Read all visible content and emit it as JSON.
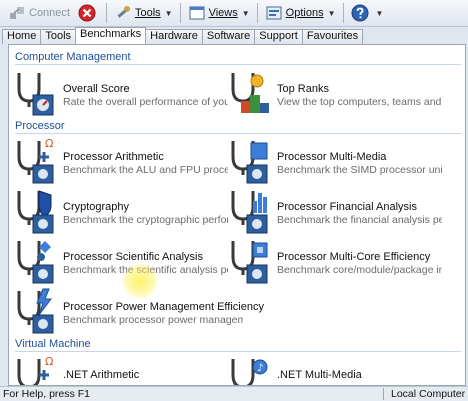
{
  "toolbar": {
    "connect_label": "Connect",
    "tools_label": "Tools",
    "views_label": "Views",
    "options_label": "Options"
  },
  "tabs": [
    "Home",
    "Tools",
    "Benchmarks",
    "Hardware",
    "Software",
    "Support",
    "Favourites"
  ],
  "active_tab": "Benchmarks",
  "sections": {
    "computer_management": "Computer Management",
    "processor": "Processor",
    "virtual_machine": "Virtual Machine"
  },
  "items": {
    "overall_score": {
      "title": "Overall Score",
      "desc": "Rate the overall performance of your co..."
    },
    "top_ranks": {
      "title": "Top Ranks",
      "desc": "View the top computers, teams and users"
    },
    "proc_arith": {
      "title": "Processor Arithmetic",
      "desc": "Benchmark the ALU and FPU processor ..."
    },
    "proc_mm": {
      "title": "Processor Multi-Media",
      "desc": "Benchmark the SIMD processor units"
    },
    "crypto": {
      "title": "Cryptography",
      "desc": "Benchmark the cryptographic performa..."
    },
    "proc_fin": {
      "title": "Processor Financial Analysis",
      "desc": "Benchmark the financial analysis perfo..."
    },
    "proc_sci": {
      "title": "Processor Scientific Analysis",
      "desc": "Benchmark the scientific analysis perfor..."
    },
    "proc_mce": {
      "title": "Processor Multi-Core Efficiency",
      "desc": "Benchmark core/module/package inter..."
    },
    "proc_power": {
      "title": "Processor Power Management Efficiency",
      "desc": "Benchmark processor power managem..."
    },
    "net_arith": {
      "title": ".NET Arithmetic",
      "desc": ""
    },
    "net_mm": {
      "title": ".NET Multi-Media",
      "desc": ""
    }
  },
  "status": {
    "left": "For Help, press F1",
    "right": "Local Computer"
  },
  "colors": {
    "section_title": "#1f4e96",
    "tab_active_bg": "#ffffff",
    "window_bg": "#dfe6ef"
  }
}
